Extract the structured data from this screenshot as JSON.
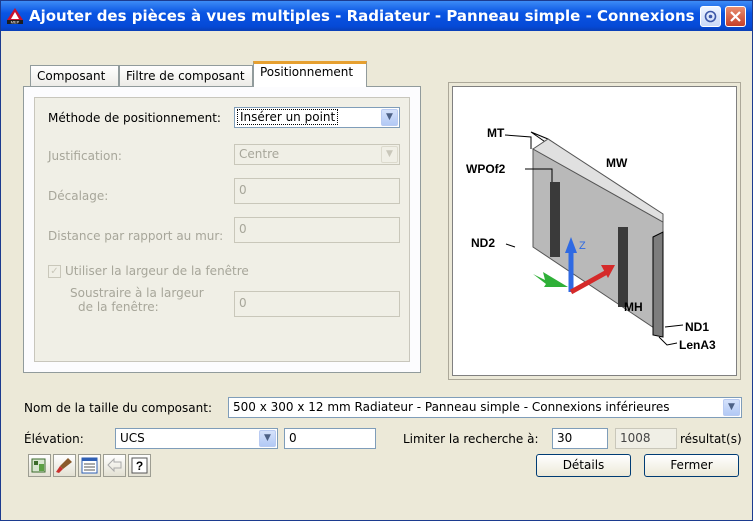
{
  "window": {
    "title": "Ajouter des pièces à vues multiples - Radiateur - Panneau simple - Connexions ir",
    "help_icon": "help-context-icon",
    "close_icon": "close-icon"
  },
  "tabs": [
    {
      "label": "Composant"
    },
    {
      "label": "Filtre de composant"
    },
    {
      "label": "Positionnement",
      "active": true
    }
  ],
  "positioning": {
    "method_label": "Méthode de positionnement:",
    "method_value": "Insérer un point",
    "justification_label": "Justification:",
    "justification_value": "Centre",
    "offset_label": "Décalage:",
    "offset_value": "0",
    "wall_distance_label": "Distance par rapport au mur:",
    "wall_distance_value": "0",
    "use_window_width_label": "Utiliser la largeur de la fenêtre",
    "use_window_width_checked": true,
    "subtract_label_line1": "Soustraire à la largeur",
    "subtract_label_line2": "de la fenêtre:",
    "subtract_value": "0"
  },
  "preview": {
    "labels": {
      "mt": "MT",
      "mw": "MW",
      "wpof2": "WPOf2",
      "nd2": "ND2",
      "mh": "MH",
      "nd1": "ND1",
      "lena3": "LenA3",
      "z": "Z"
    }
  },
  "footer": {
    "size_name_label": "Nom de la taille du composant:",
    "size_name_value": "500 x 300 x 12 mm Radiateur - Panneau simple - Connexions inférieures",
    "elevation_label": "Élévation:",
    "elevation_mode": "UCS",
    "elevation_value": "0",
    "limit_label": "Limiter la recherche à:",
    "limit_value": "30",
    "result_count": "1008",
    "result_label": "résultat(s)",
    "details_button": "Détails",
    "close_button": "Fermer"
  },
  "toolbar_icons": [
    "catalog-icon",
    "paint-brush-icon",
    "properties-icon",
    "undo-arrow-icon",
    "help-icon"
  ],
  "colors": {
    "titlebar": "#0a55e3",
    "dialog_bg": "#ece9d8",
    "active_tab_accent": "#e6a030"
  }
}
